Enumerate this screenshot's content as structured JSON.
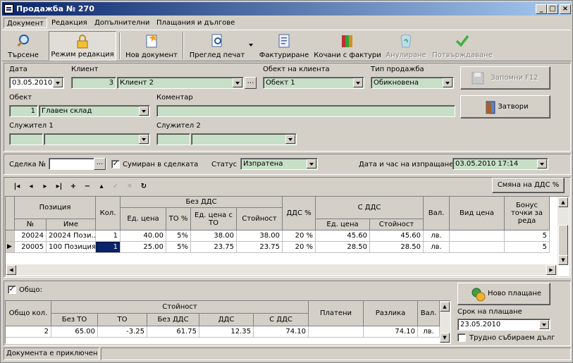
{
  "window": {
    "title": "Продажба № 270"
  },
  "menu": [
    "Документ",
    "Редакция",
    "Допълнителни",
    "Плащания и дългове"
  ],
  "toolbar": {
    "search": "Търсене",
    "edit_mode": "Режим редакция",
    "new_doc": "Нов документ",
    "print_preview": "Преглед печат",
    "invoicing": "Фактуриране",
    "invoice_carts": "Кочани с фактури",
    "cancel": "Анулиране",
    "confirm": "Потвърждаване"
  },
  "header": {
    "date_label": "Дата",
    "date": "03.05.2010",
    "client_label": "Клиент",
    "client_id": "3",
    "client_name": "Клиент 2",
    "client_object_label": "Обект на клиента",
    "client_object": "Обект 1",
    "sale_type_label": "Тип продажба",
    "sale_type": "Обикновена",
    "object_label": "Обект",
    "object_id": "1",
    "object_name": "Главен склад",
    "comment_label": "Коментар",
    "comment": "",
    "employee1_label": "Служител 1",
    "employee2_label": "Служител 2",
    "save_button": "Запомни  F12",
    "close_button": "Затвори"
  },
  "deal": {
    "deal_label": "Сделка №",
    "deal_value": "",
    "summed_label": "Сумиран в сделката",
    "status_label": "Статус",
    "status": "Изпратена",
    "send_label": "Дата и час на изпращане",
    "send_value": "03.05.2010 17:14",
    "vat_change_button": "Смяна на ДДС %"
  },
  "items_grid": {
    "headers": {
      "position": "Позиция",
      "no": "№",
      "name": "Име",
      "qty": "Кол.",
      "without_vat": "Без ДДС",
      "unit_price": "Ед. цена",
      "to_pct": "ТО %",
      "unit_price_to": "Ед. цена с ТО",
      "value": "Стойност",
      "vat_pct": "ДДС %",
      "with_vat": "С ДДС",
      "unit_price2": "Ед. цена",
      "value2": "Стойност",
      "currency": "Вал.",
      "price_type": "Вид цена",
      "bonus": "Бонус точки за реда"
    },
    "rows": [
      {
        "no": "20024",
        "name": "20024 Пози...",
        "qty": "1",
        "price": "40.00",
        "to": "5%",
        "price_to": "38.00",
        "value": "38.00",
        "vat": "20 %",
        "price_vat": "45.60",
        "value_vat": "45.60",
        "cur": "лв.",
        "ptype": "",
        "bonus": "5"
      },
      {
        "no": "20005",
        "name": "100 Позиция",
        "qty": "1",
        "price": "25.00",
        "to": "5%",
        "price_to": "23.75",
        "value": "23.75",
        "vat": "20 %",
        "price_vat": "28.50",
        "value_vat": "28.50",
        "cur": "лв.",
        "ptype": "",
        "bonus": "5"
      }
    ]
  },
  "totals": {
    "total_label": "Общо:",
    "new_payment_button": "Ново плащане",
    "due_label": "Срок на плащане",
    "due_date": "23.05.2010",
    "hard_debt_label": "Трудно събираем дълг",
    "headers": {
      "qty": "Общо кол.",
      "value": "Стойност",
      "no_to": "Без ТО",
      "to": "ТО",
      "no_vat": "Без ДДС",
      "vat": "ДДС",
      "with_vat": "С ДДС",
      "paid": "Платени",
      "diff": "Разлика",
      "cur": "Вал."
    },
    "row": {
      "qty": "2",
      "no_to": "65.00",
      "to": "-3.25",
      "no_vat": "61.75",
      "vat": "12.35",
      "with_vat": "74.10",
      "paid": "",
      "diff": "74.10",
      "cur": "лв."
    }
  },
  "status": {
    "text": "Документа е приключен"
  }
}
